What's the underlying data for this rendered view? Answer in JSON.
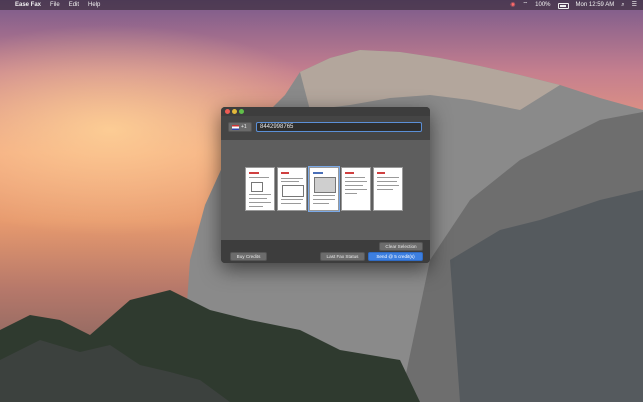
{
  "menubar": {
    "app_name": "Ease Fax",
    "menus": [
      "File",
      "Edit",
      "Help"
    ],
    "battery": "100%",
    "clock": "Mon 12:59 AM"
  },
  "window": {
    "country_code": "+1",
    "fax_number": "8442998765",
    "thumbnail_count": 5,
    "buttons": {
      "clear_selection": "Clear Selection",
      "buy_credits": "Buy Credits",
      "last_fax_status": "Last Fax Status",
      "send": "Send @ 5 credit(s)"
    }
  },
  "colors": {
    "accent": "#3d7fe0",
    "window_bg": "#3a3a3a"
  },
  "icons": [
    "apple-icon",
    "wifi-icon",
    "battery-icon",
    "spotlight-icon",
    "notification-icon",
    "flag-icon"
  ]
}
